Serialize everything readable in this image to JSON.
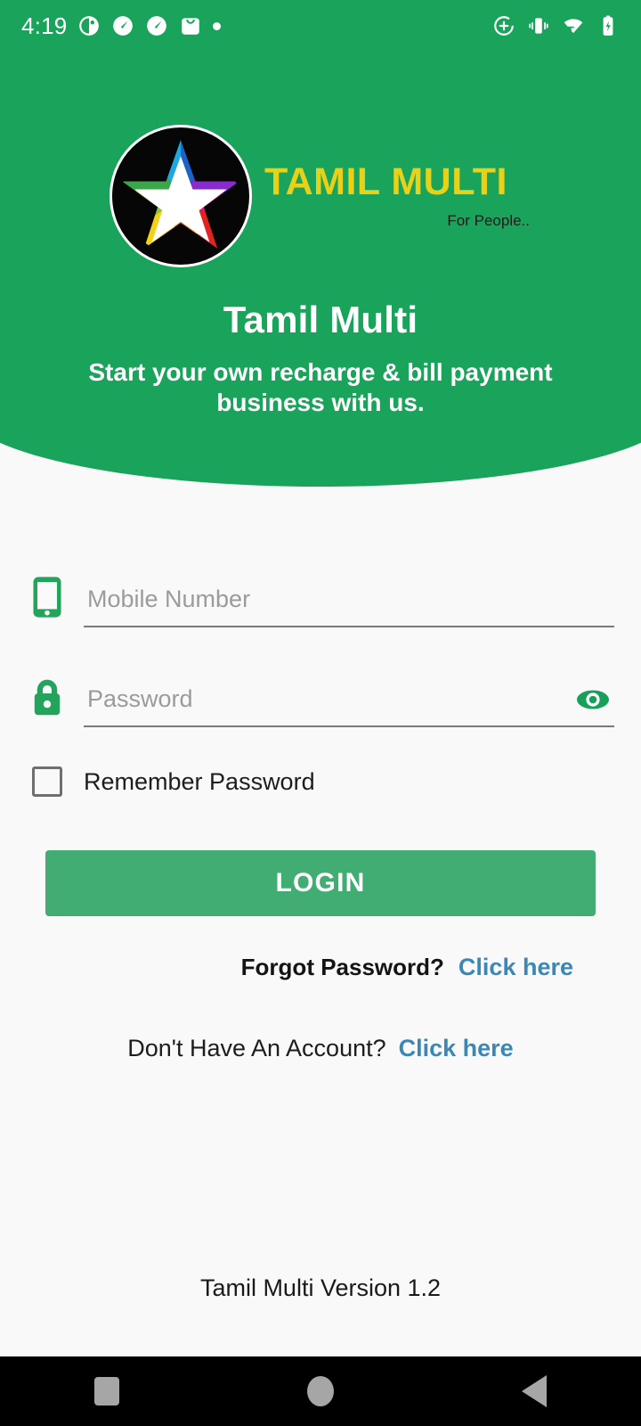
{
  "status_bar": {
    "time": "4:19",
    "left_icons": [
      "app-notification-icon",
      "speedometer-icon",
      "speedometer-icon",
      "shopping-bag-icon",
      "dot-icon"
    ],
    "right_icons": [
      "add-circle-icon",
      "vibrate-icon",
      "wifi-icon",
      "battery-charging-icon"
    ]
  },
  "logo": {
    "brand_name": "TAMIL MULTI",
    "tagline": "For People..",
    "mark": "rainbow-star-icon",
    "brand_color": "#e8d117"
  },
  "hero": {
    "title": "Tamil Multi",
    "subtitle": "Start your own recharge & bill payment business with us."
  },
  "form": {
    "mobile": {
      "icon": "phone-icon",
      "placeholder": "Mobile Number",
      "value": ""
    },
    "password": {
      "icon": "lock-icon",
      "placeholder": "Password",
      "value": "",
      "toggle_icon": "eye-icon"
    },
    "remember": {
      "label": "Remember Password",
      "checked": false
    },
    "login_label": "LOGIN"
  },
  "links": {
    "forgot_prompt": "Forgot Password?",
    "forgot_link": "Click here",
    "signup_prompt": "Don't Have An Account?",
    "signup_link": "Click here",
    "link_color": "#3b87b5"
  },
  "footer": {
    "version": "Tamil Multi Version 1.2"
  },
  "nav_bar": {
    "recents": "recents-square-icon",
    "home": "home-circle-icon",
    "back": "back-triangle-icon"
  },
  "theme": {
    "header_green": "#1aa35a",
    "button_green": "#41ad72",
    "page_bg": "#f9f9f9"
  }
}
